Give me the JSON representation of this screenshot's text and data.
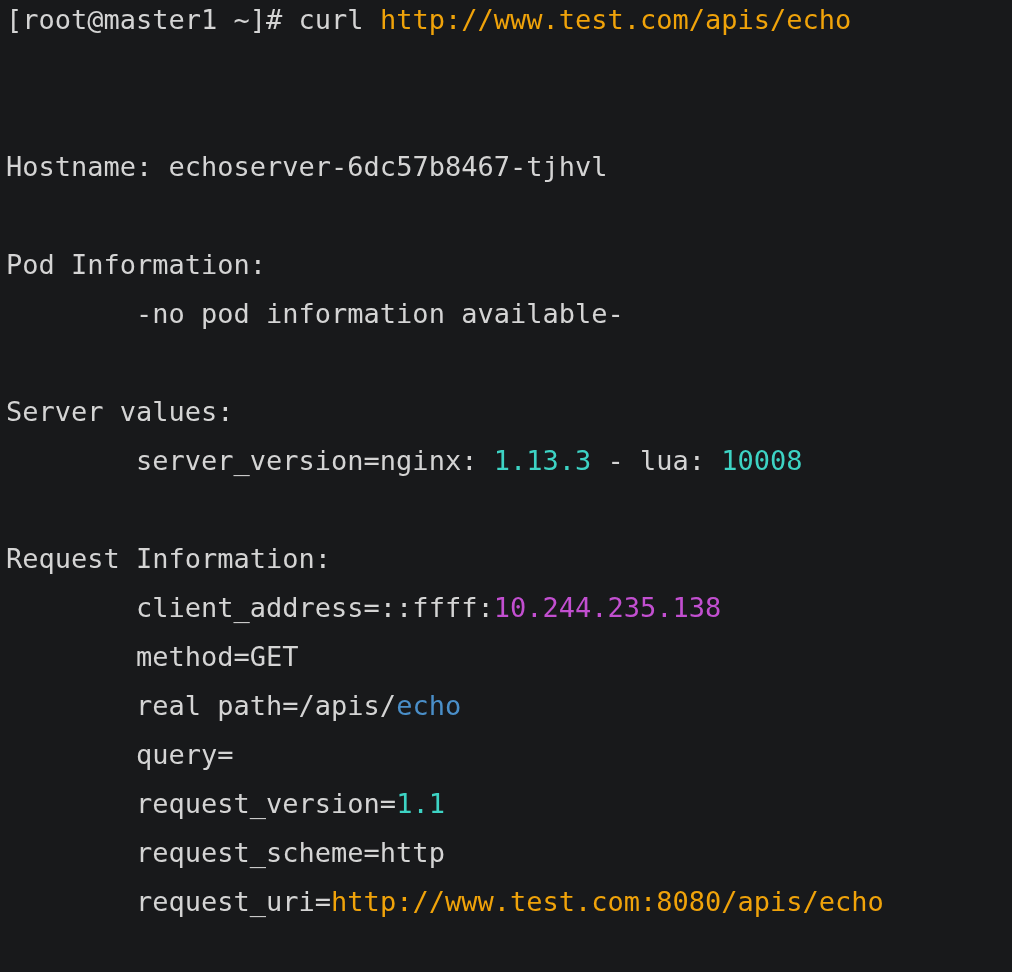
{
  "command": {
    "segments": [
      {
        "text": "[root@master1 ~]# curl ",
        "color": "#d4d4d4"
      },
      {
        "text": "http://www.test.com/apis/echo",
        "color": "#f0a30a"
      }
    ]
  },
  "output": [
    {
      "segments": [
        {
          "text": "Hostname: echoserver-6dc57b8467-tjhvl",
          "color": "#d4d4d4"
        }
      ]
    },
    {
      "segments": [
        {
          "text": "Pod Information:",
          "color": "#d4d4d4"
        }
      ],
      "children": [
        {
          "segments": [
            {
              "text": "-no pod information available-",
              "color": "#d4d4d4"
            }
          ]
        }
      ]
    },
    {
      "segments": [
        {
          "text": "Server values:",
          "color": "#d4d4d4"
        }
      ],
      "children": [
        {
          "segments": [
            {
              "text": "server_version=nginx: ",
              "color": "#d4d4d4"
            },
            {
              "text": "1.13.3",
              "color": "#3dd3c4"
            },
            {
              "text": " - lua: ",
              "color": "#d4d4d4"
            },
            {
              "text": "10008",
              "color": "#3dd3c4"
            }
          ]
        }
      ]
    },
    {
      "segments": [
        {
          "text": "Request Information:",
          "color": "#d4d4d4"
        }
      ],
      "children": [
        {
          "segments": [
            {
              "text": "client_address=::ffff:",
              "color": "#d4d4d4"
            },
            {
              "text": "10.244.235.138",
              "color": "#c24fd0"
            }
          ]
        },
        {
          "segments": [
            {
              "text": "method=GET",
              "color": "#d4d4d4"
            }
          ]
        },
        {
          "segments": [
            {
              "text": "real path=/apis/",
              "color": "#d4d4d4"
            },
            {
              "text": "echo",
              "color": "#4a8fc9"
            }
          ]
        },
        {
          "segments": [
            {
              "text": "query=",
              "color": "#d4d4d4"
            }
          ]
        },
        {
          "segments": [
            {
              "text": "request_version=",
              "color": "#d4d4d4"
            },
            {
              "text": "1.1",
              "color": "#3dd3c4"
            }
          ]
        },
        {
          "segments": [
            {
              "text": "request_scheme=http",
              "color": "#d4d4d4"
            }
          ]
        },
        {
          "segments": [
            {
              "text": "request_uri=",
              "color": "#d4d4d4"
            },
            {
              "text": "http://www.test.com:8080/apis/echo",
              "color": "#f0a30a"
            }
          ]
        }
      ]
    }
  ]
}
